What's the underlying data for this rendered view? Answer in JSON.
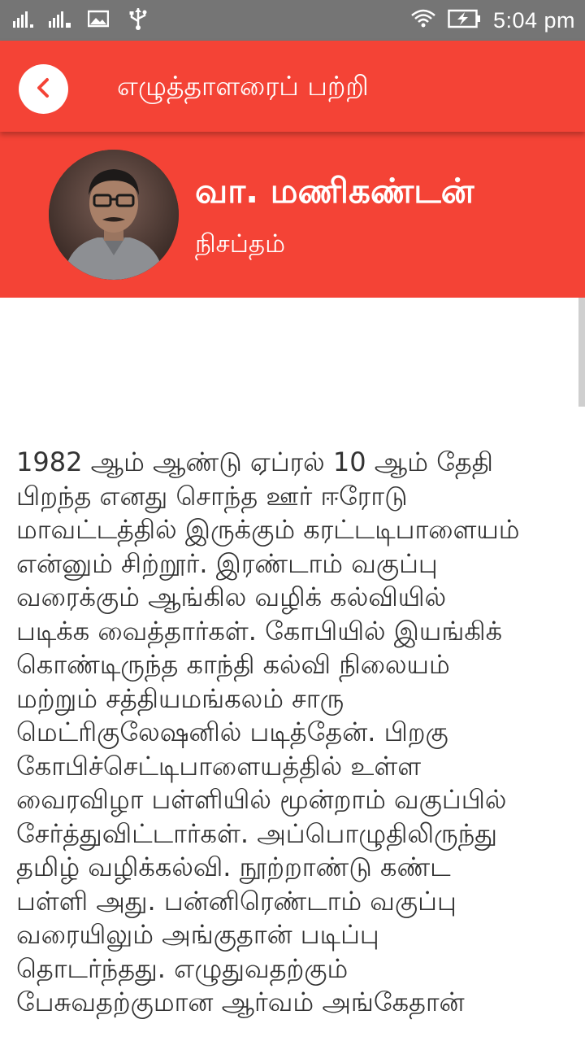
{
  "status_bar": {
    "time": "5:04 pm",
    "icons": [
      "signal-1-icon",
      "signal-2-icon",
      "image-icon",
      "usb-icon",
      "wifi-icon",
      "battery-charging-icon"
    ]
  },
  "app_bar": {
    "title": "எழுத்தாளரைப் பற்றி",
    "back_icon": "chevron-left-icon"
  },
  "author": {
    "name": "வா. மணிகண்டன்",
    "blog": "நிசப்தம்"
  },
  "colors": {
    "accent": "#f44336",
    "status_bar": "#757575",
    "text": "#333333"
  },
  "bio": {
    "lines": [
      "1982 ஆம் ஆண்டு ஏப்ரல் 10 ஆம் தேதி",
      "பிறந்த எனது சொந்த ஊர் ஈரோடு",
      "மாவட்டத்தில் இருக்கும் கரட்டடிபாளையம்",
      "என்னும் சிற்றூர். இரண்டாம் வகுப்பு",
      "வரைக்கும் ஆங்கில வழிக் கல்வியில்",
      "படிக்க வைத்தார்கள். கோபியில் இயங்கிக்",
      "கொண்டிருந்த காந்தி கல்வி நிலையம்",
      "மற்றும் சத்தியமங்கலம் சாரு",
      "மெட்ரிகுலேஷனில் படித்தேன். பிறகு",
      "கோபிச்செட்டிபாளையத்தில் உள்ள",
      "வைரவிழா பள்ளியில் மூன்றாம் வகுப்பில்",
      "சேர்த்துவிட்டார்கள். அப்பொழுதிலிருந்து",
      "தமிழ் வழிக்கல்வி. நூற்றாண்டு கண்ட",
      "பள்ளி அது. பன்னிரெண்டாம் வகுப்பு",
      "வரையிலும் அங்குதான் படிப்பு",
      "தொடர்ந்தது. எழுதுவதற்கும்",
      "பேசுவதற்குமான ஆர்வம் அங்கேதான்"
    ]
  }
}
